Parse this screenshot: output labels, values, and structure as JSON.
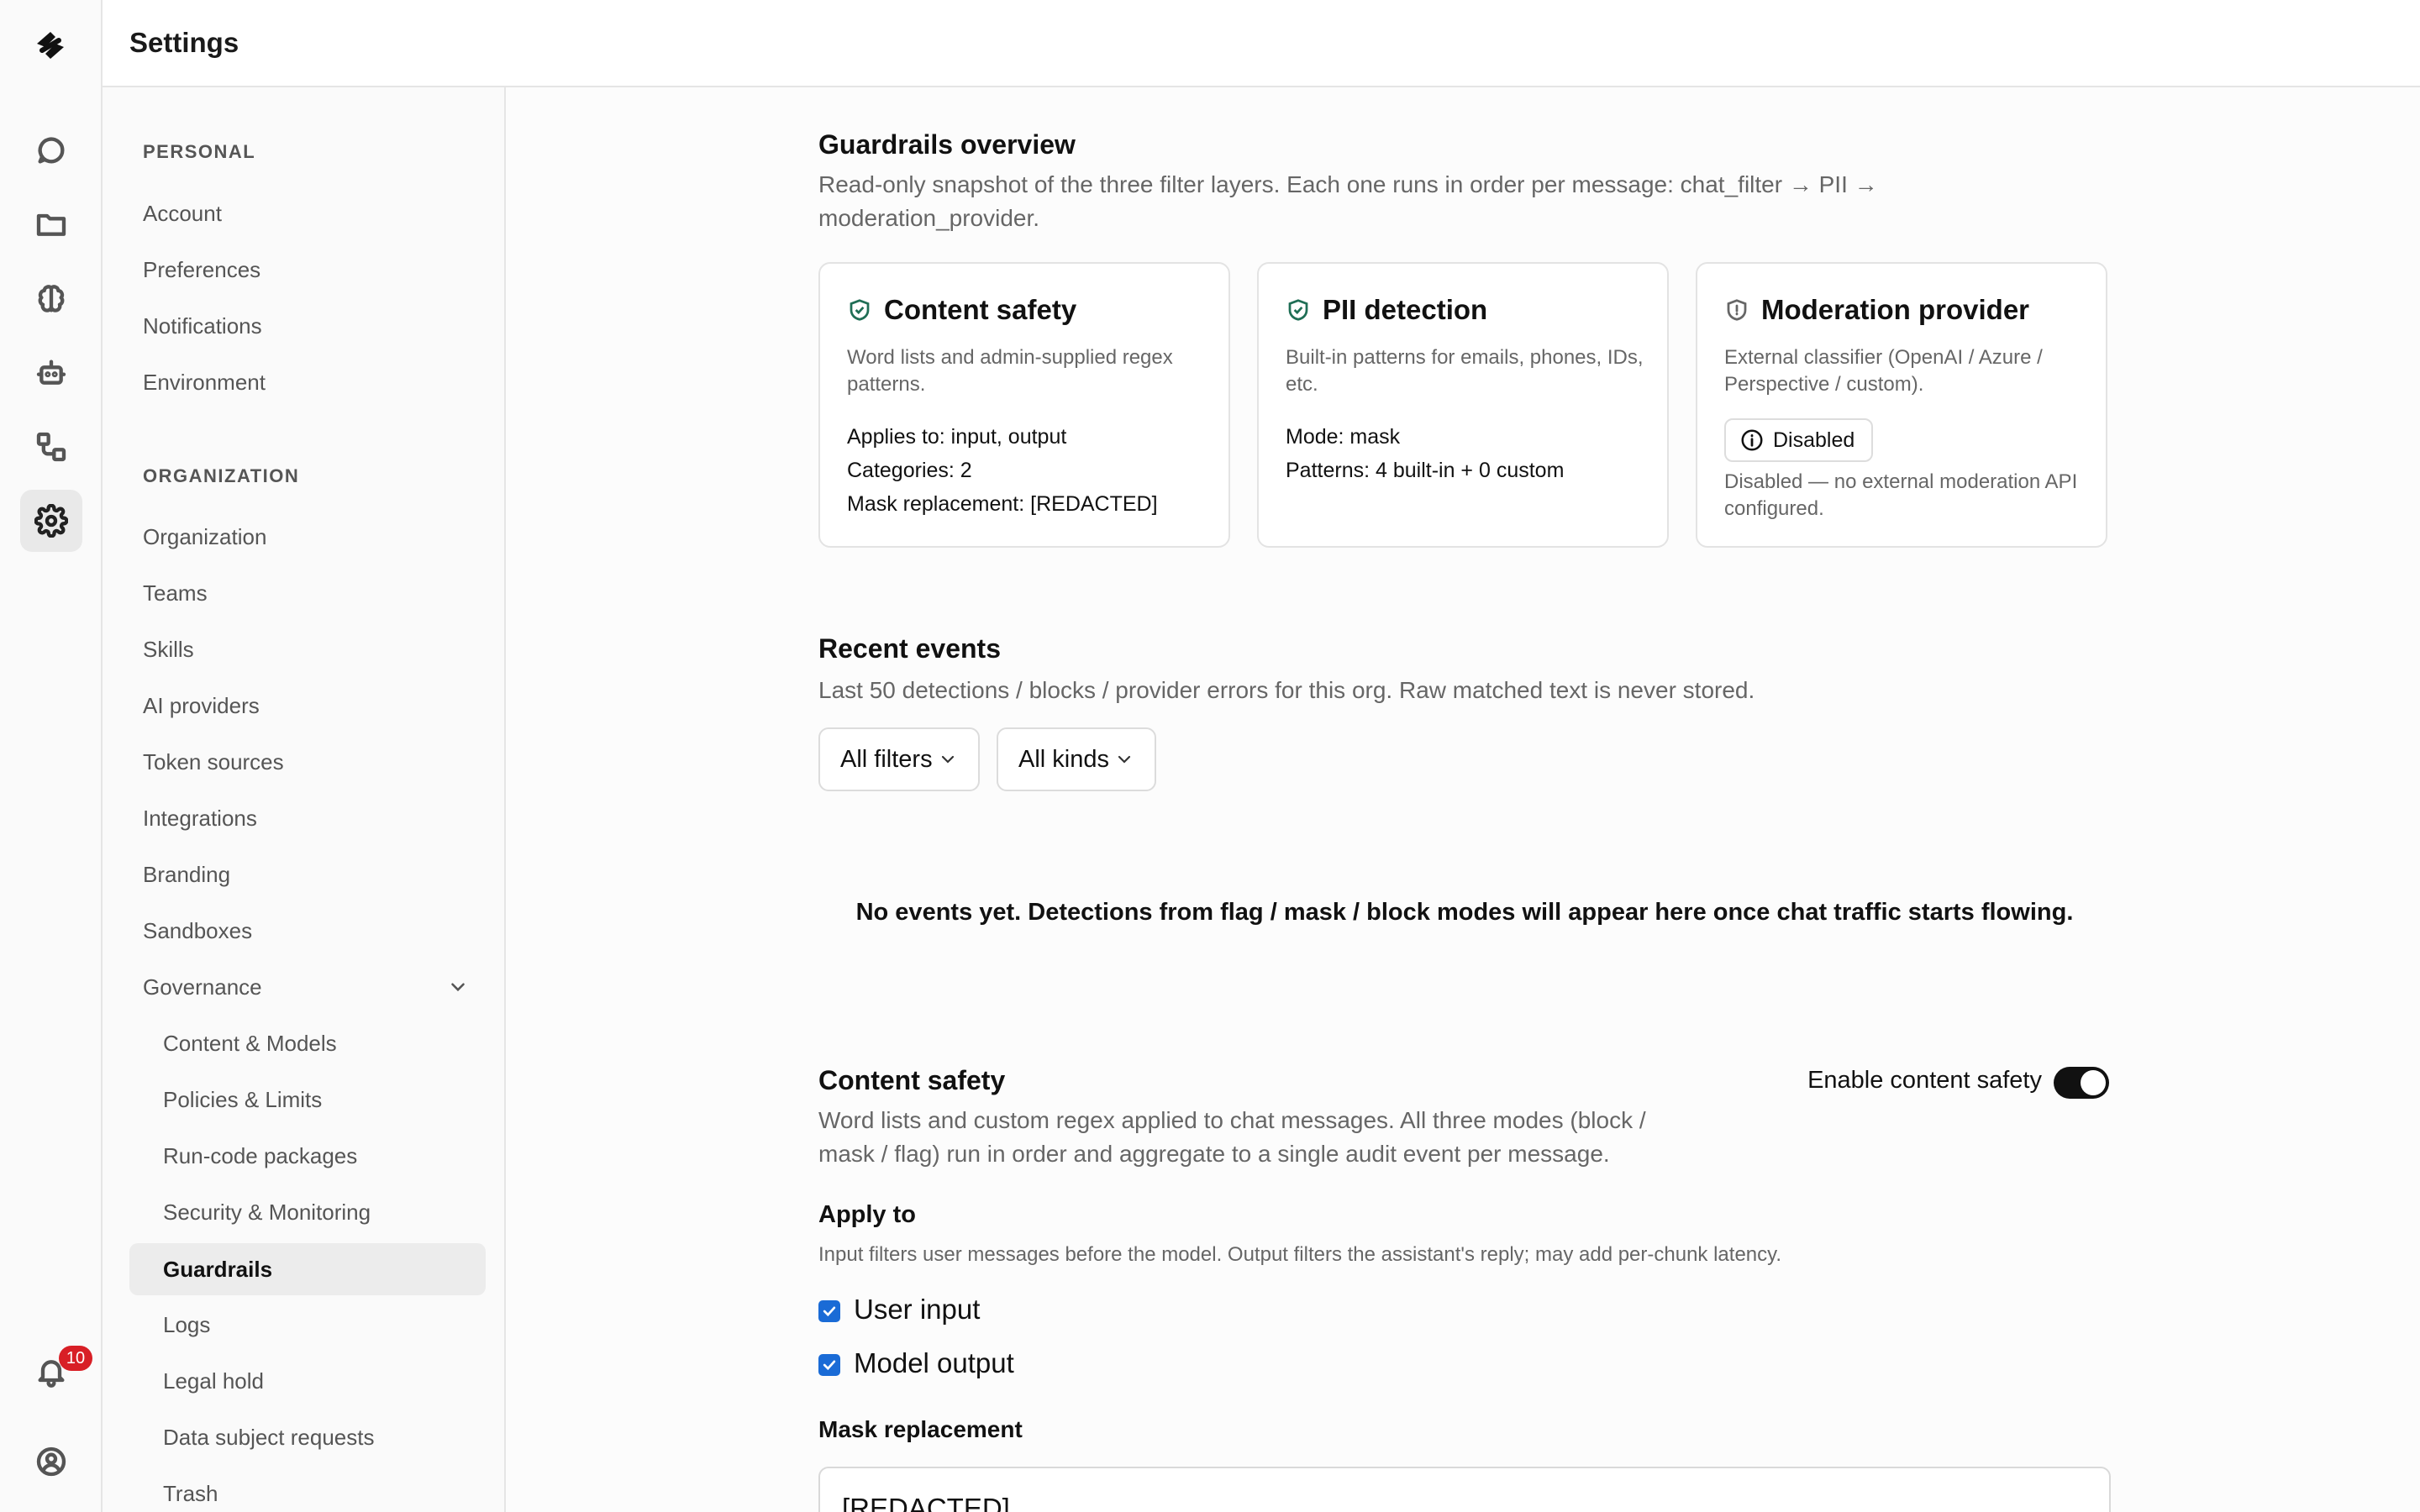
{
  "header": {
    "title": "Settings"
  },
  "rail": {
    "items": [
      {
        "icon": "chat-icon"
      },
      {
        "icon": "folder-icon"
      },
      {
        "icon": "brain-icon"
      },
      {
        "icon": "bot-icon"
      },
      {
        "icon": "workflow-icon"
      },
      {
        "icon": "gear-icon",
        "active": true
      }
    ],
    "notifications_count": "10"
  },
  "nav": {
    "personal_heading": "PERSONAL",
    "personal": [
      "Account",
      "Preferences",
      "Notifications",
      "Environment"
    ],
    "org_heading": "ORGANIZATION",
    "org": [
      "Organization",
      "Teams",
      "Skills",
      "AI providers",
      "Token sources",
      "Integrations",
      "Branding",
      "Sandboxes",
      "Governance"
    ],
    "governance": [
      "Content & Models",
      "Policies & Limits",
      "Run-code packages",
      "Security & Monitoring",
      "Guardrails",
      "Logs",
      "Legal hold",
      "Data subject requests",
      "Trash"
    ],
    "active": "Guardrails"
  },
  "overview": {
    "title": "Guardrails overview",
    "desc_line1": "Read-only snapshot of the three filter layers. Each one runs in order per message: chat_filter → PII →",
    "desc_line2": "moderation_provider.",
    "cards": {
      "content_safety": {
        "title": "Content safety",
        "desc": "Word lists and admin-supplied regex patterns.",
        "lines": [
          "Applies to: input, output",
          "Categories: 2",
          "Mask replacement: [REDACTED]"
        ]
      },
      "pii": {
        "title": "PII detection",
        "desc": "Built-in patterns for emails, phones, IDs, etc.",
        "lines": [
          "Mode: mask",
          "Patterns: 4 built-in + 0 custom"
        ]
      },
      "moderation": {
        "title": "Moderation provider",
        "desc": "External classifier (OpenAI / Azure / Perspective / custom).",
        "status": "Disabled",
        "note": "Disabled — no external moderation API configured."
      }
    }
  },
  "events": {
    "title": "Recent events",
    "desc": "Last 50 detections / blocks / provider errors for this org. Raw matched text is never stored.",
    "filter_select": "All filters",
    "kind_select": "All kinds",
    "empty": "No events yet. Detections from flag / mask / block modes will appear here once chat traffic starts flowing."
  },
  "content_safety": {
    "title": "Content safety",
    "toggle_label": "Enable content safety",
    "enabled": true,
    "desc_line1": "Word lists and custom regex applied to chat messages. All three modes (block /",
    "desc_line2": "mask / flag) run in order and aggregate to a single audit event per message.",
    "apply_to_label": "Apply to",
    "apply_to_help": "Input filters user messages before the model. Output filters the assistant's reply; may add per-chunk latency.",
    "user_input_label": "User input",
    "model_output_label": "Model output",
    "mask_label": "Mask replacement",
    "mask_value": "[REDACTED]"
  },
  "colors": {
    "accent": "#1a6bd6",
    "shield_green": "#1f6e55",
    "badge": "#d81f26"
  }
}
